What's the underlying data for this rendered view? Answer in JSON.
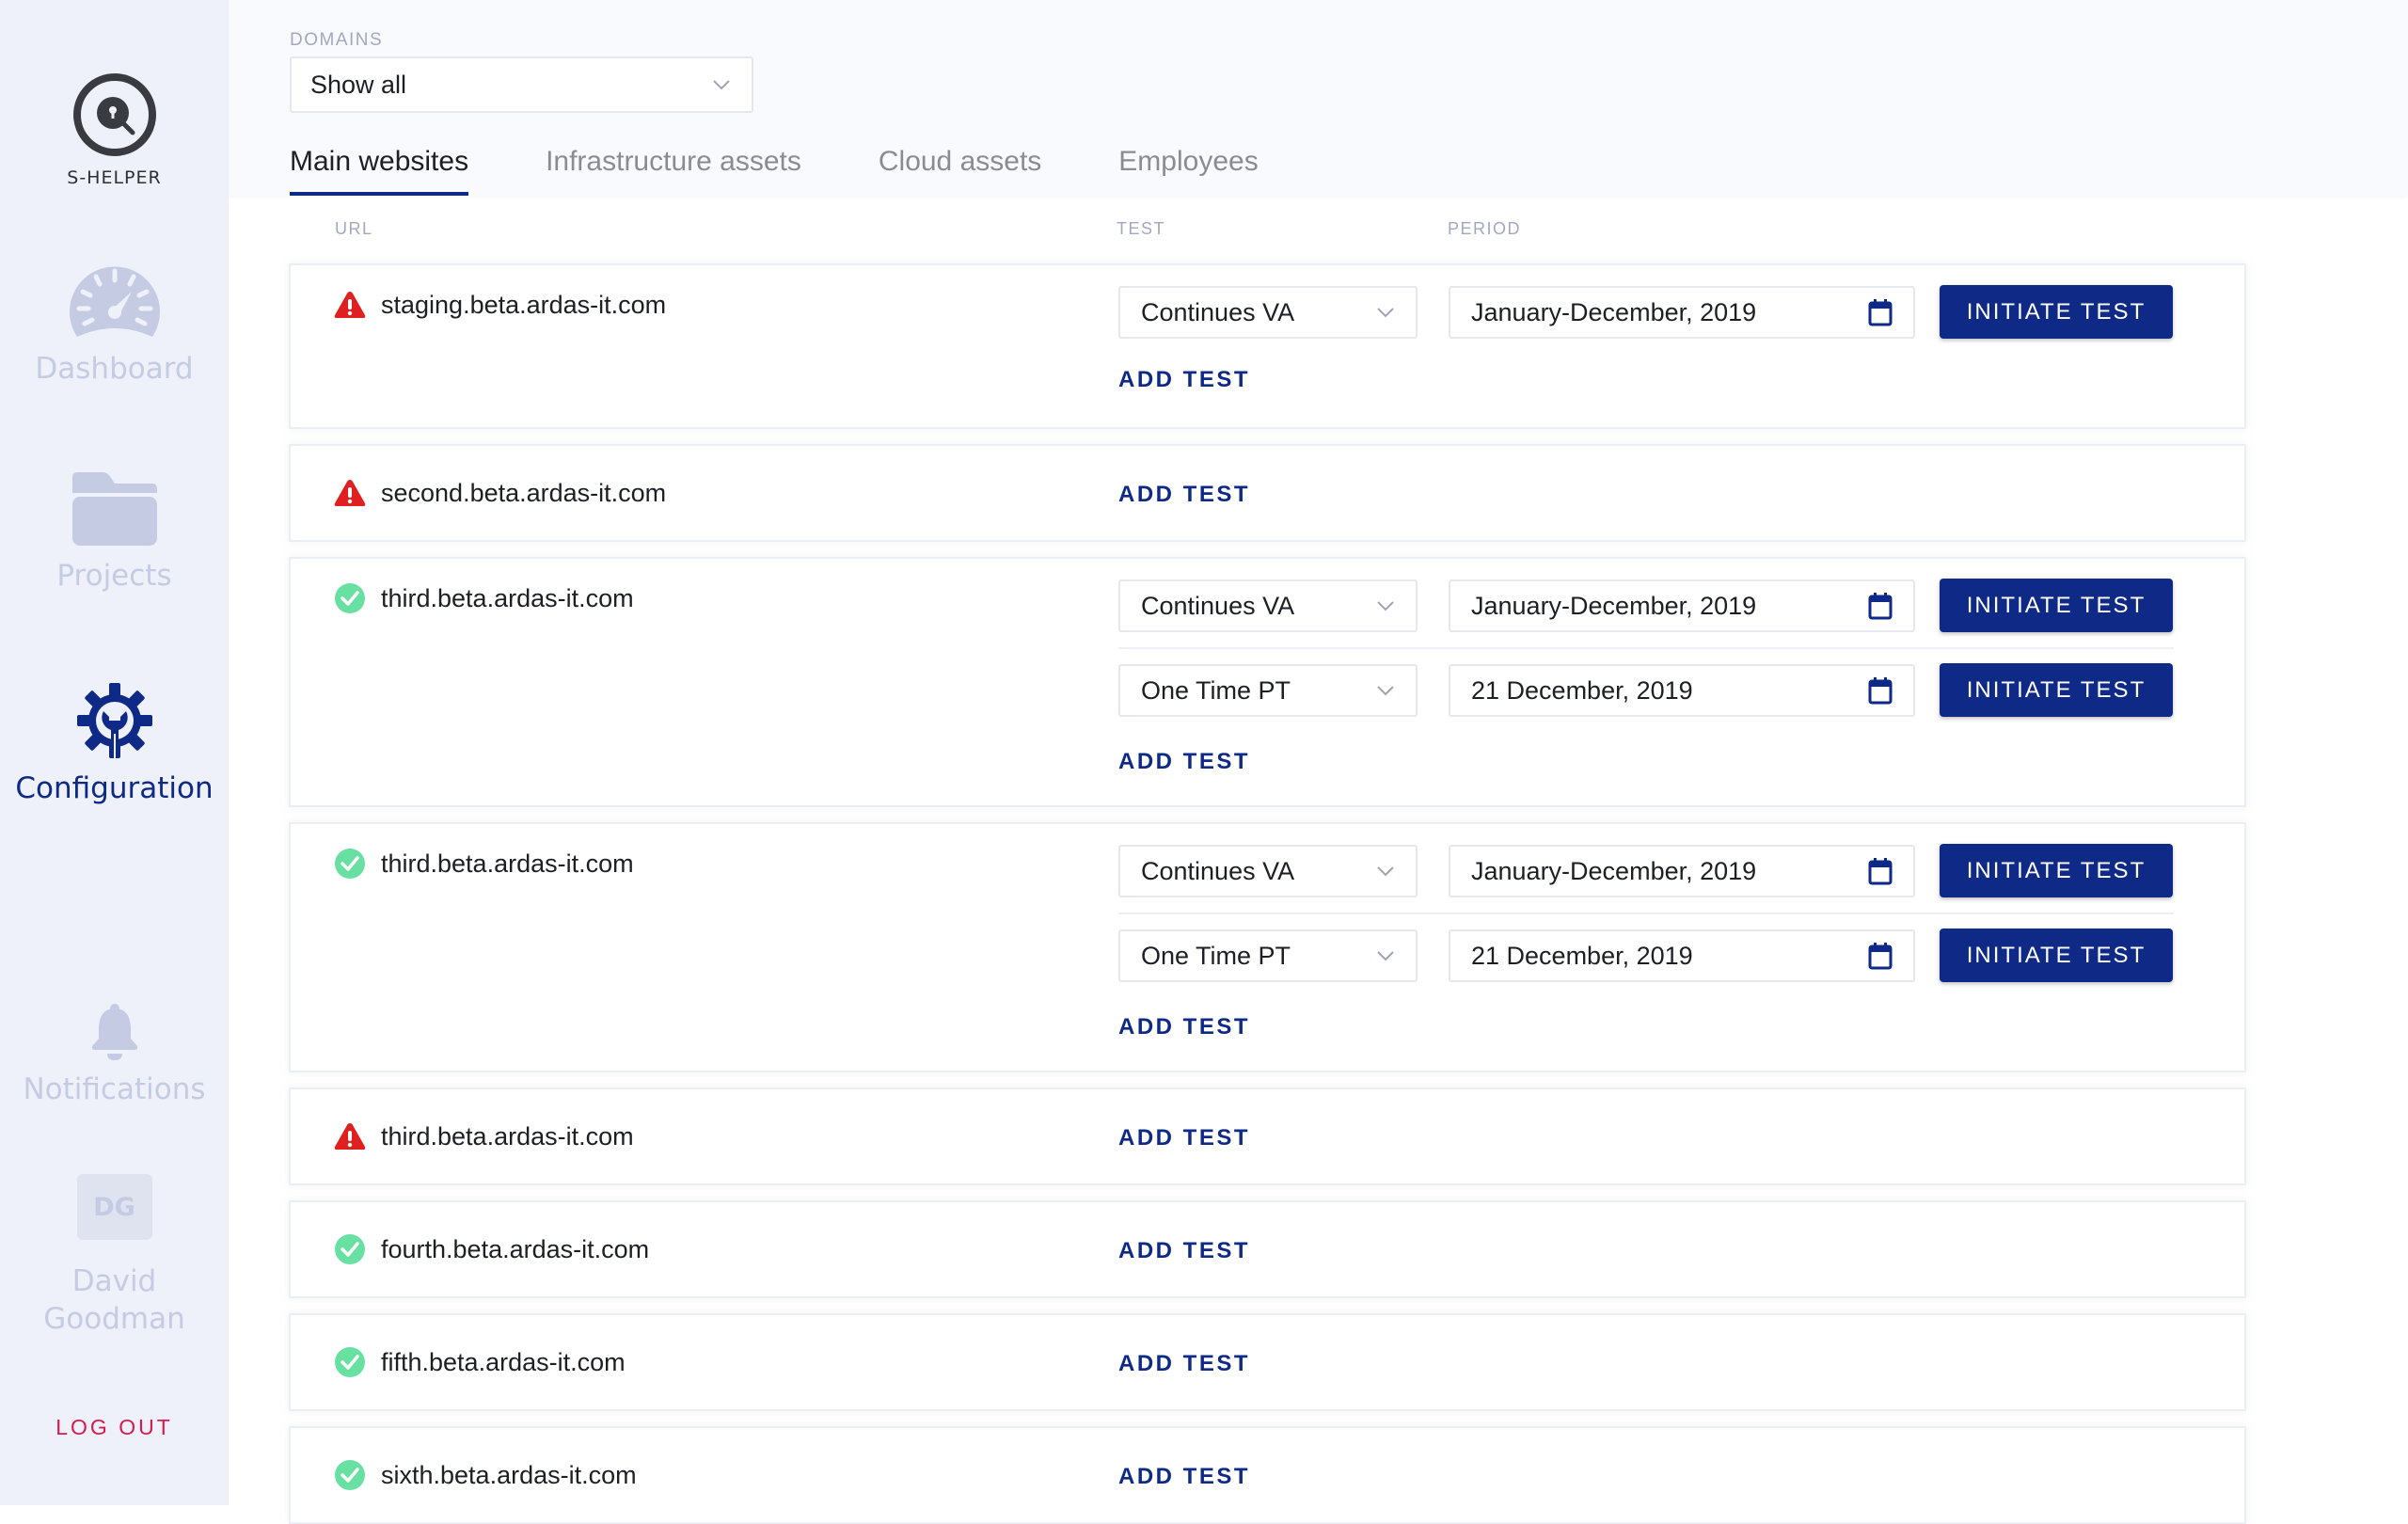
{
  "sidebar": {
    "brand": "S-HELPER",
    "nav": [
      {
        "label": "Dashboard",
        "icon": "dashboard-gauge-icon",
        "active": false
      },
      {
        "label": "Projects",
        "icon": "folder-icon",
        "active": false
      },
      {
        "label": "Configuration",
        "icon": "gear-wrench-icon",
        "active": true
      },
      {
        "label": "Notifications",
        "icon": "bell-icon",
        "active": false
      }
    ],
    "user": {
      "initials": "DG",
      "name_line1": "David",
      "name_line2": "Goodman"
    },
    "logout_label": "LOG OUT"
  },
  "header": {
    "domains_label": "DOMAINS",
    "domains_value": "Show all",
    "tabs": [
      {
        "label": "Main websites",
        "active": true
      },
      {
        "label": "Infrastructure assets",
        "active": false
      },
      {
        "label": "Cloud assets",
        "active": false
      },
      {
        "label": "Employees",
        "active": false
      }
    ]
  },
  "columns": {
    "url": "URL",
    "test": "TEST",
    "period": "PERIOD"
  },
  "labels": {
    "add_test": "ADD TEST",
    "initiate_test": "INITIATE TEST"
  },
  "colors": {
    "accent": "#0f2a86",
    "warning": "#e02020",
    "success": "#68e0a2",
    "logout": "#d61a4c"
  },
  "sites": [
    {
      "url": "staging.beta.ardas-it.com",
      "status": "warning",
      "tests": [
        {
          "type": "Continues VA",
          "period": "January-December, 2019"
        }
      ]
    },
    {
      "url": "second.beta.ardas-it.com",
      "status": "warning",
      "tests": []
    },
    {
      "url": "third.beta.ardas-it.com",
      "status": "ok",
      "tests": [
        {
          "type": "Continues VA",
          "period": "January-December, 2019"
        },
        {
          "type": "One Time PT",
          "period": "21 December, 2019"
        }
      ]
    },
    {
      "url": "third.beta.ardas-it.com",
      "status": "ok",
      "tests": [
        {
          "type": "Continues VA",
          "period": "January-December, 2019"
        },
        {
          "type": "One Time PT",
          "period": "21 December, 2019"
        }
      ]
    },
    {
      "url": "third.beta.ardas-it.com",
      "status": "warning",
      "tests": []
    },
    {
      "url": "fourth.beta.ardas-it.com",
      "status": "ok",
      "tests": []
    },
    {
      "url": "fifth.beta.ardas-it.com",
      "status": "ok",
      "tests": []
    },
    {
      "url": "sixth.beta.ardas-it.com",
      "status": "ok",
      "tests": []
    }
  ]
}
